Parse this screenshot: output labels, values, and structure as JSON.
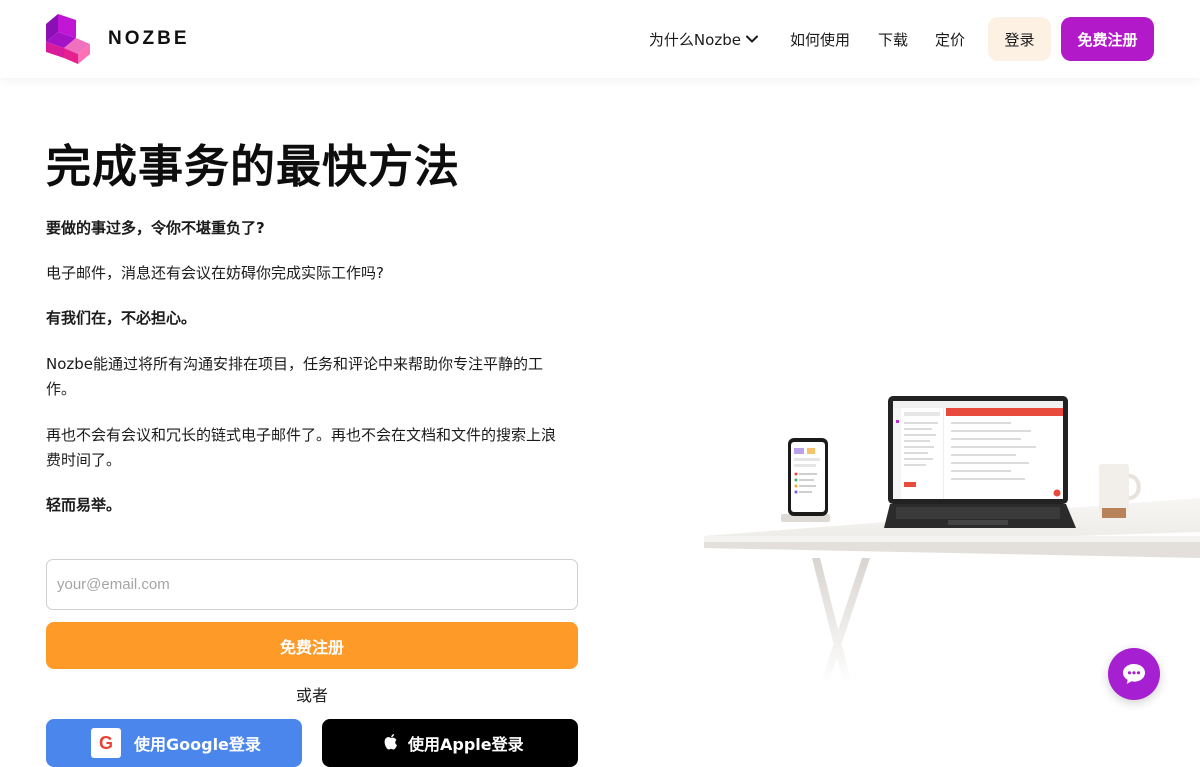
{
  "brand": {
    "name": "NOZBE",
    "colors": {
      "pink": "#e5208f",
      "purple": "#b219c8",
      "orange": "#fd9a28",
      "google_blue": "#4b86ec"
    }
  },
  "nav": {
    "why": "为什么Nozbe",
    "how": "如何使用",
    "download": "下载",
    "pricing": "定价",
    "login": "登录",
    "signup": "免费注册"
  },
  "hero": {
    "title": "完成事务的最快方法",
    "paragraphs": [
      "要做的事过多，令你不堪重负了?",
      "电子邮件，消息还有会议在妨碍你完成实际工作吗?",
      "有我们在，不必担心。",
      "Nozbe能通过将所有沟通安排在项目，任务和评论中来帮助你专注平静的工作。",
      "再也不会有会议和冗长的链式电子邮件了。再也不会在文档和文件的搜索上浪费时间了。",
      "轻而易举。"
    ]
  },
  "signup_form": {
    "email_placeholder": "your@email.com",
    "submit": "免费注册",
    "or": "或者",
    "google": "使用Google登录",
    "apple": "使用Apple登录"
  },
  "icons": {
    "logo": "nozbe-cube-logo",
    "dropdown": "chevron-down-icon",
    "google": "google-g-icon",
    "apple": "apple-icon",
    "chat": "chat-bubble-icon"
  }
}
